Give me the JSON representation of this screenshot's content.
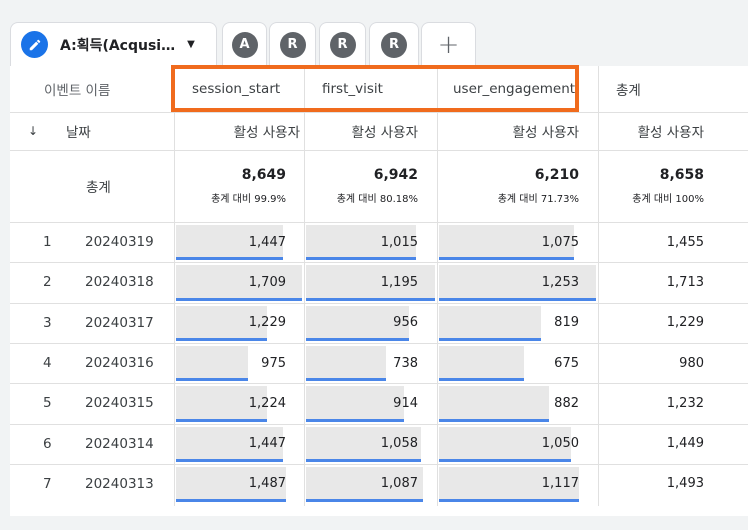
{
  "tabs": {
    "main_label": "A:획득(Acqusi…",
    "segments": [
      "A",
      "R",
      "R",
      "R"
    ],
    "add_symbol": "+"
  },
  "table": {
    "dimension_header": "이벤트 이름",
    "sort_icon": "arrow-down-icon",
    "date_header": "날짜",
    "columns": [
      {
        "name": "session_start",
        "metric": "활성 사용자",
        "total": "8,649",
        "share": "총계 대비 99.9%"
      },
      {
        "name": "first_visit",
        "metric": "활성 사용자",
        "total": "6,942",
        "share": "총계 대비 80.18%"
      },
      {
        "name": "user_engagement",
        "metric": "활성 사용자",
        "total": "6,210",
        "share": "총계 대비 71.73%"
      },
      {
        "name": "총계",
        "metric": "활성 사용자",
        "total": "8,658",
        "share": "총계 대비 100%"
      }
    ],
    "total_label": "총계",
    "rows": [
      {
        "index": "1",
        "date": "20240319",
        "values": [
          "1,447",
          "1,015",
          "1,075",
          "1,455"
        ]
      },
      {
        "index": "2",
        "date": "20240318",
        "values": [
          "1,709",
          "1,195",
          "1,253",
          "1,713"
        ]
      },
      {
        "index": "3",
        "date": "20240317",
        "values": [
          "1,229",
          "956",
          "819",
          "1,229"
        ]
      },
      {
        "index": "4",
        "date": "20240316",
        "values": [
          "975",
          "738",
          "675",
          "980"
        ]
      },
      {
        "index": "5",
        "date": "20240315",
        "values": [
          "1,224",
          "914",
          "882",
          "1,232"
        ]
      },
      {
        "index": "6",
        "date": "20240314",
        "values": [
          "1,447",
          "1,058",
          "1,050",
          "1,449"
        ]
      },
      {
        "index": "7",
        "date": "20240313",
        "values": [
          "1,487",
          "1,087",
          "1,117",
          "1,493"
        ]
      }
    ],
    "bar_fractions": [
      [
        0.85,
        0.85,
        0.86
      ],
      [
        1.0,
        1.0,
        1.0
      ],
      [
        0.72,
        0.8,
        0.65
      ],
      [
        0.57,
        0.62,
        0.54
      ],
      [
        0.72,
        0.76,
        0.7
      ],
      [
        0.85,
        0.89,
        0.84
      ],
      [
        0.87,
        0.91,
        0.89
      ]
    ]
  },
  "colors": {
    "accent": "#1a73e8",
    "bar_fill": "#e8e8e8",
    "bar_line": "#4a86e8",
    "highlight": "#f06b1d"
  }
}
